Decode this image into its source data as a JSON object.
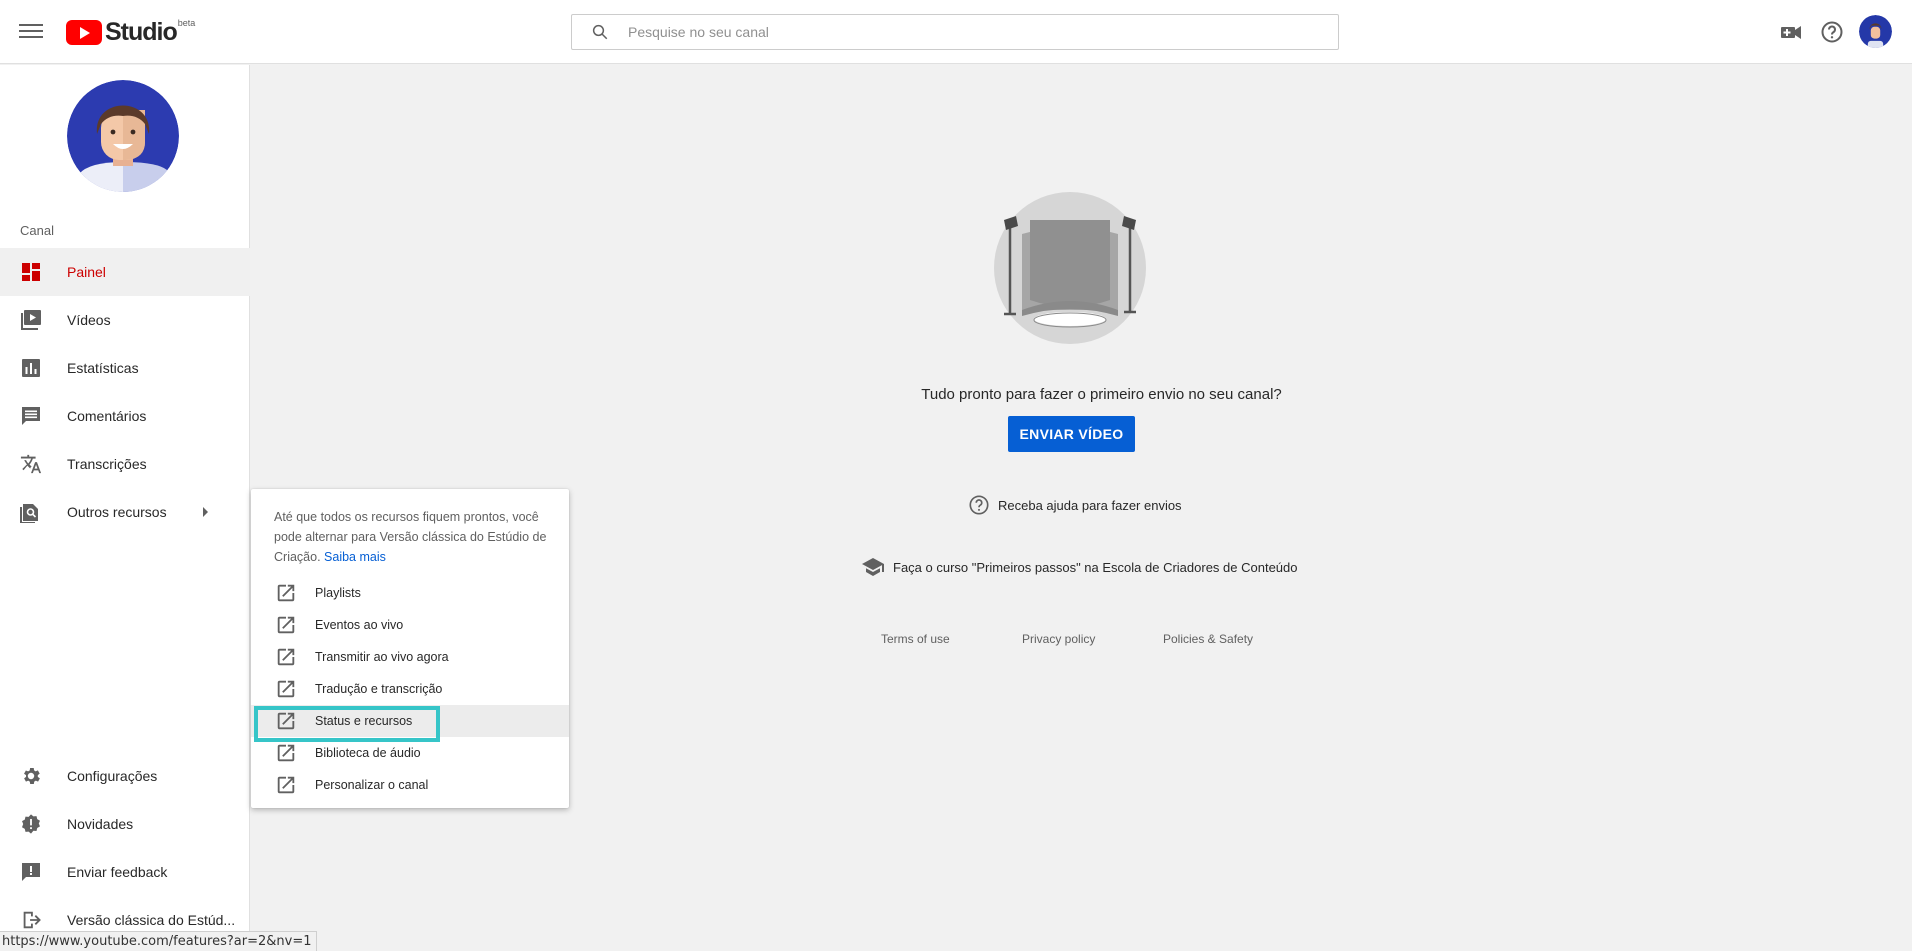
{
  "header": {
    "logo_text": "Studio",
    "logo_badge": "beta",
    "search_placeholder": "Pesquise no seu canal"
  },
  "sidebar": {
    "section_label": "Canal",
    "items": [
      {
        "label": "Painel",
        "icon": "dashboard-icon",
        "active": true
      },
      {
        "label": "Vídeos",
        "icon": "video-library-icon"
      },
      {
        "label": "Estatísticas",
        "icon": "analytics-icon"
      },
      {
        "label": "Comentários",
        "icon": "comment-icon"
      },
      {
        "label": "Transcrições",
        "icon": "translate-icon"
      },
      {
        "label": "Outros recursos",
        "icon": "find-in-page-icon"
      }
    ],
    "bottom_items": [
      {
        "label": "Configurações",
        "icon": "gear-icon"
      },
      {
        "label": "Novidades",
        "icon": "alert-badge-icon"
      },
      {
        "label": "Enviar feedback",
        "icon": "feedback-icon"
      },
      {
        "label": "Versão clássica do Estúd...",
        "icon": "exit-icon"
      }
    ]
  },
  "main": {
    "prompt": "Tudo pronto para fazer o primeiro envio no seu canal?",
    "upload_button": "ENVIAR VÍDEO",
    "help_link": "Receba ajuda para fazer envios",
    "course_link": "Faça o curso \"Primeiros passos\" na Escola de Criadores de Conteúdo",
    "footer": {
      "terms": "Terms of use",
      "privacy": "Privacy policy",
      "policies": "Policies & Safety"
    }
  },
  "popup": {
    "info_text": "Até que todos os recursos fiquem prontos, você pode alternar para Versão clássica do Estúdio de Criação.",
    "info_link": "Saiba mais",
    "items": [
      {
        "label": "Playlists"
      },
      {
        "label": "Eventos ao vivo"
      },
      {
        "label": "Transmitir ao vivo agora"
      },
      {
        "label": "Tradução e transcrição"
      },
      {
        "label": "Status e recursos",
        "highlighted": true
      },
      {
        "label": "Biblioteca de áudio"
      },
      {
        "label": "Personalizar o canal"
      }
    ]
  },
  "statusbar": {
    "url": "https://www.youtube.com/features?ar=2&nv=1"
  },
  "colors": {
    "accent_red": "#cc0000",
    "button_blue": "#065fd4",
    "highlight_cyan": "#36c5c8"
  }
}
